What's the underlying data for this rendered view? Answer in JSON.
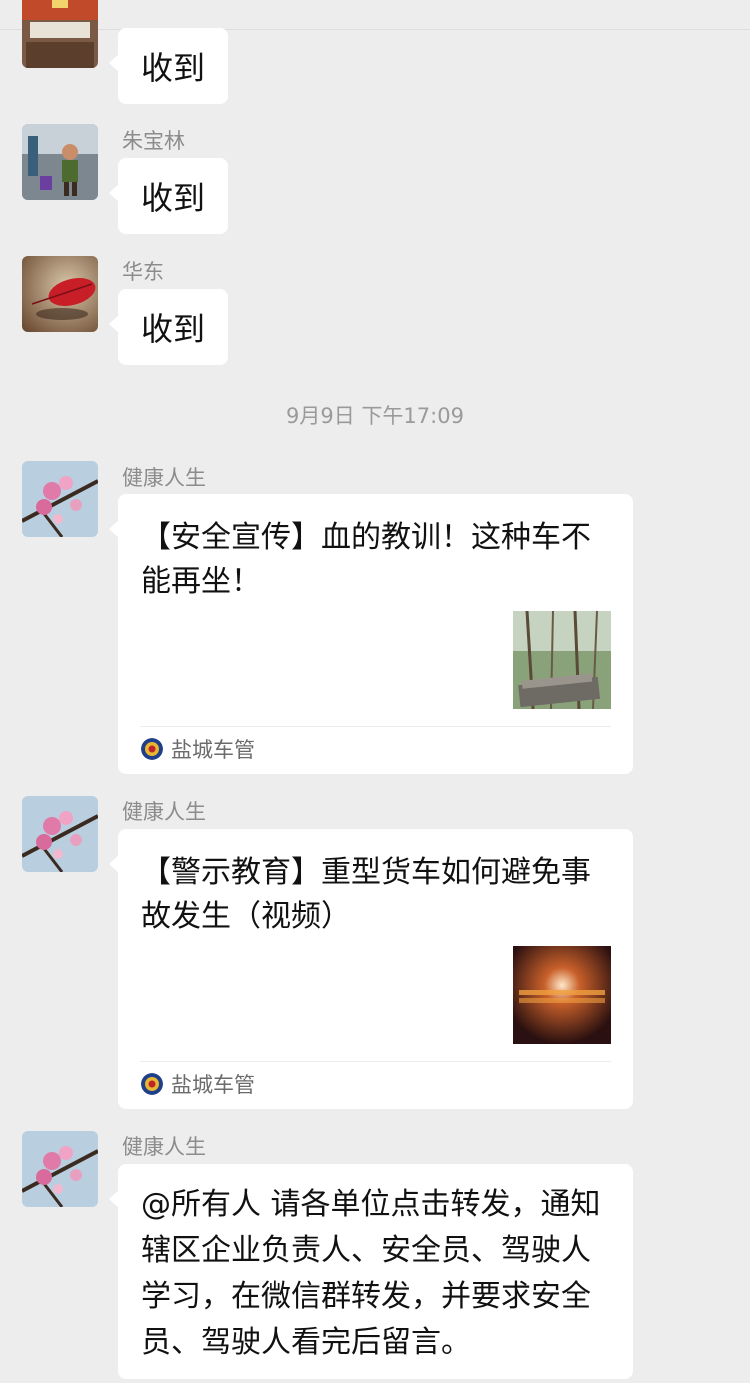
{
  "messages": [
    {
      "sender": "",
      "text": "收到"
    },
    {
      "sender": "朱宝林",
      "text": "收到"
    },
    {
      "sender": "华东",
      "text": "收到"
    }
  ],
  "timestamp": "9月9日 下午17:09",
  "cards": [
    {
      "sender": "健康人生",
      "title": "【安全宣传】血的教训！这种车不能再坐！",
      "source": "盐城车管",
      "thumbnail_icon": "forest-crash-thumbnail"
    },
    {
      "sender": "健康人生",
      "title": "【警示教育】重型货车如何避免事故发生（视频）",
      "source": "盐城车管",
      "thumbnail_icon": "video-thumbnail"
    }
  ],
  "last_message": {
    "sender": "健康人生",
    "text": "@所有人 请各单位点击转发，通知辖区企业负责人、安全员、驾驶人学习，在微信群转发，并要求安全员、驾驶人看完后留言。"
  },
  "colors": {
    "background": "#ededed",
    "bubble": "#ffffff",
    "meta_text": "#8c8c8c"
  }
}
